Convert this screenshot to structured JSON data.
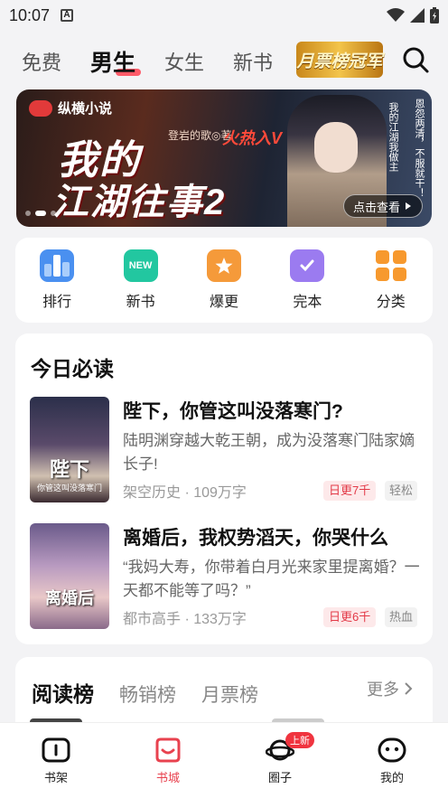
{
  "status": {
    "time": "10:07"
  },
  "top_tabs": [
    {
      "label": "免费"
    },
    {
      "label": "男生"
    },
    {
      "label": "女生"
    },
    {
      "label": "新书"
    }
  ],
  "promo_label": "月票榜冠军",
  "banner": {
    "brand": "纵横小说",
    "title_line1": "我的",
    "title_line2": "江湖往事2",
    "author": "登岩的歌◎著",
    "hot": "火热入V",
    "quote1": "我的江湖我做主",
    "quote2": "恩怨两清，不服就干！",
    "cta": "点击查看"
  },
  "quick_entries": [
    {
      "label": "排行",
      "color": "#4a90f0"
    },
    {
      "label": "新书",
      "color": "#22c7a0",
      "badge": "NEW"
    },
    {
      "label": "爆更",
      "color": "#f59a3a"
    },
    {
      "label": "完本",
      "color": "#9b7bf0"
    },
    {
      "label": "分类",
      "color": "#f7992e"
    }
  ],
  "today": {
    "heading": "今日必读",
    "books": [
      {
        "title": "陛下，你管这叫没落寒门?",
        "desc": "陆明渊穿越大乾王朝，成为没落寒门陆家嫡长子!",
        "meta": "架空历史 · 109万字",
        "tag_update": "日更7千",
        "tag_style": "轻松",
        "cover_title": "陛下",
        "cover_sub": "你管这叫没落寒门"
      },
      {
        "title": "离婚后，我权势滔天，你哭什么",
        "desc": "“我妈大寿，你带着白月光来家里提离婚？一天都不能等了吗？”",
        "meta": "都市高手 · 133万字",
        "tag_update": "日更6千",
        "tag_style": "热血",
        "cover_title": "离婚后"
      }
    ]
  },
  "rank": {
    "tabs": [
      {
        "label": "阅读榜"
      },
      {
        "label": "畅销榜"
      },
      {
        "label": "月票榜"
      }
    ],
    "more": "更多"
  },
  "bottom_nav": [
    {
      "label": "书架"
    },
    {
      "label": "书城"
    },
    {
      "label": "圈子",
      "badge": "上新"
    },
    {
      "label": "我的"
    }
  ],
  "colors": {
    "accent": "#e8424f"
  }
}
